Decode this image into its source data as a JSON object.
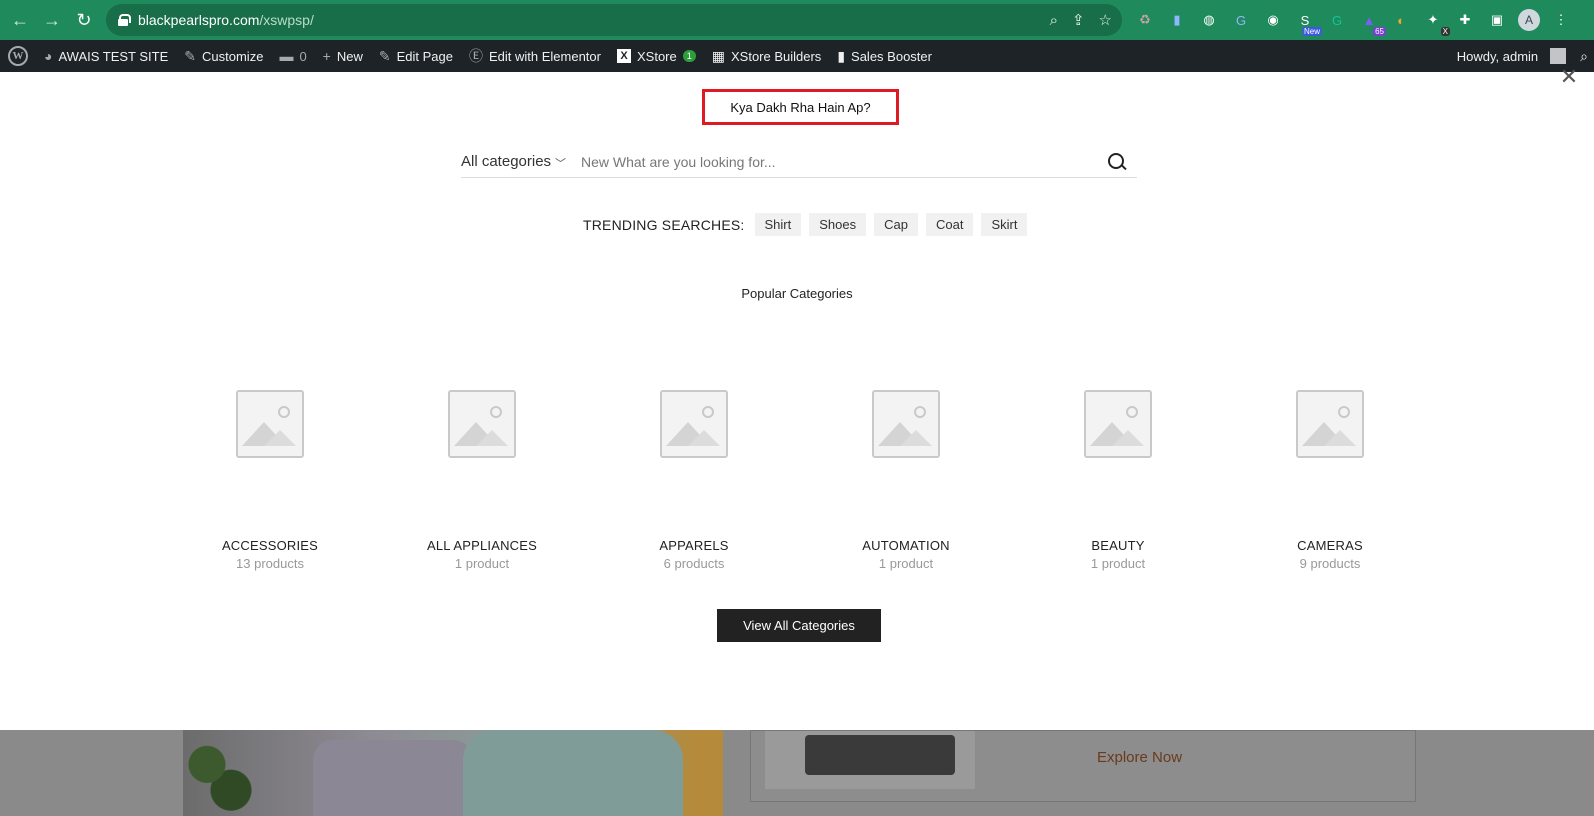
{
  "browser": {
    "url_host": "blackpearlspro.com",
    "url_path": "/xswpsp/",
    "extension_badge_new": "New",
    "extension_badge_count": "65",
    "extension_badge_x": "X",
    "profile_initial": "A"
  },
  "admin_bar": {
    "site_name": "AWAIS TEST SITE",
    "customize": "Customize",
    "comments_count": "0",
    "new": "New",
    "edit_page": "Edit Page",
    "edit_elementor": "Edit with Elementor",
    "xstore": "XStore",
    "xstore_badge": "1",
    "xstore_builders": "XStore Builders",
    "sales_booster": "Sales Booster",
    "howdy": "Howdy, admin"
  },
  "overlay": {
    "headline": "Kya Dakh Rha Hain Ap?",
    "category_select": "All categories",
    "search_placeholder": "New What are you looking for...",
    "trending_label": "TRENDING SEARCHES:",
    "trending_tags": [
      "Shirt",
      "Shoes",
      "Cap",
      "Coat",
      "Skirt"
    ],
    "popular_title": "Popular Categories",
    "categories": [
      {
        "name": "ACCESSORIES",
        "count": "13 products"
      },
      {
        "name": "ALL APPLIANCES",
        "count": "1 product"
      },
      {
        "name": "APPARELS",
        "count": "6 products"
      },
      {
        "name": "AUTOMATION",
        "count": "1 product"
      },
      {
        "name": "BEAUTY",
        "count": "1 product"
      },
      {
        "name": "CAMERAS",
        "count": "9 products"
      }
    ],
    "view_all": "View All Categories"
  },
  "background_page": {
    "explore_link": "Explore Now"
  },
  "colors": {
    "browser_green": "#1f8a5b",
    "highlight_red": "#e01a22",
    "admin_bar": "#1d2327"
  }
}
